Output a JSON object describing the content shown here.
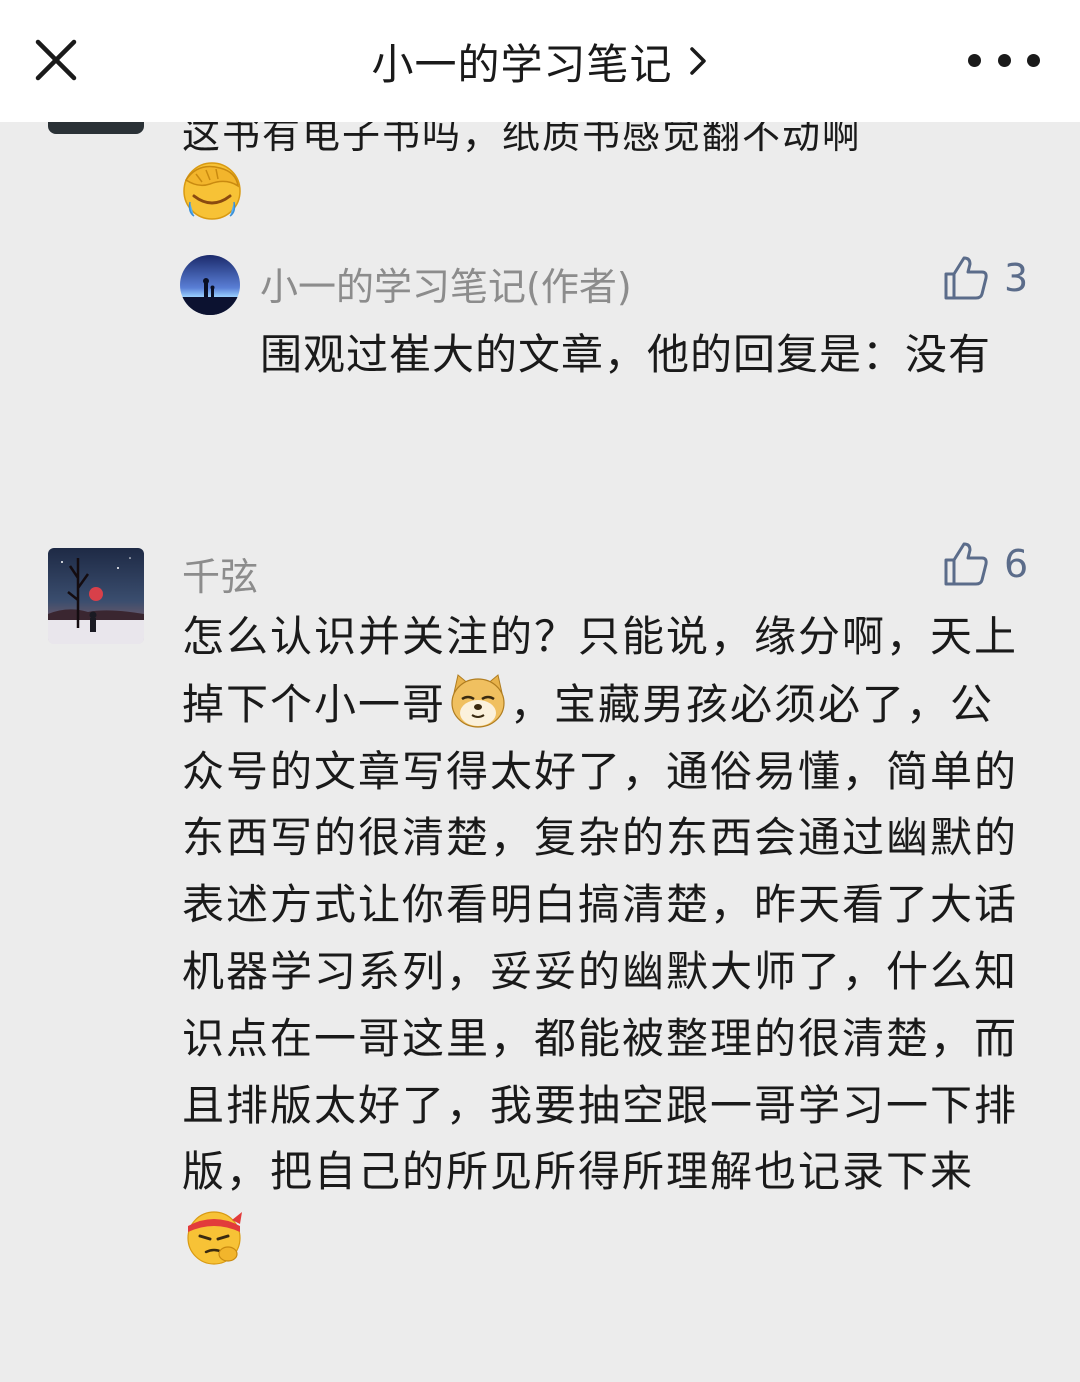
{
  "header": {
    "close_icon": "close-icon",
    "title": "小一的学习笔记",
    "chevron_icon": "chevron-right-icon",
    "more_icon": "more-icon"
  },
  "prev_comment": {
    "text_clipped": "这书有电子书吗，纸质书感觉翻不动啊",
    "emoji": "facepalm-emoji"
  },
  "reply": {
    "author": "小一的学习笔记(作者)",
    "likes": "3",
    "text": "围观过崔大的文章，他的回复是：没有"
  },
  "comment": {
    "author": "千弦",
    "likes": "6",
    "text_part1": "怎么认识并关注的？只能说，缘分啊，天上掉下个小一哥",
    "emoji1": "doge-emoji",
    "text_part2": "，宝藏男孩必须必了，公众号的文章写得太好了，通俗易懂，简单的东西写的很清楚，复杂的东西会通过幽默的表述方式让你看明白搞清楚，昨天看了大话机器学习系列，妥妥的幽默大师了，什么知识点在一哥这里，都能被整理的很清楚，而且排版太好了，我要抽空跟一哥学习一下排版，把自己的所见所得所理解也记录下来",
    "emoji2": "determined-emoji"
  },
  "colors": {
    "background": "#ececec",
    "header_bg": "#ffffff",
    "name_gray": "#8c8c8c",
    "like_blue": "#5b6c8a",
    "text": "#1a1a1a"
  }
}
